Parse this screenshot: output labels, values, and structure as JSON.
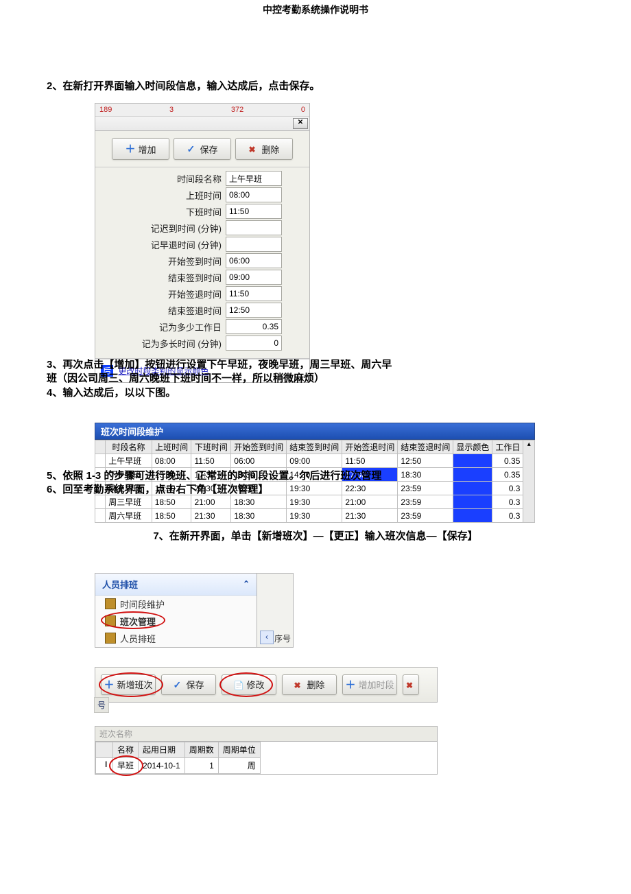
{
  "doc": {
    "title": "中控考勤系统操作说明书",
    "step2": "2、在新打开界面输入时间段信息，输入达成后，点击保存。",
    "step3_line1": "3、再次点击【增加】按钮进行设置下午早班，夜晚早班，周三早班、周六早",
    "step3_line2": "班（因公司周三、周六晚班下班时间不一样，所以稍微麻烦）",
    "step4": "4、输入达成后，以以下图。",
    "step5": "5、依照 1-3 的步骤可进行晚班、正常班的时间段设置。尔后进行班次管理",
    "step6": "6、回至考勤系统界面，点击右下角【班次管理】",
    "step7": "7、在新开界面，单击【新增班次】—【更正】输入班次信息—【保存】"
  },
  "dialog1": {
    "ruler": {
      "a": "189",
      "b": "3",
      "c": "372",
      "d": "0"
    },
    "buttons": {
      "add": "增加",
      "save": "保存",
      "delete": "删除"
    },
    "labels": {
      "name": "时间段名称",
      "start": "上班时间",
      "end": "下班时间",
      "late": "记迟到时间 (分钟)",
      "early": "记早退时间 (分钟)",
      "sign_in_start": "开始签到时间",
      "sign_in_end": "结束签到时间",
      "sign_out_start": "开始签退时间",
      "sign_out_end": "结束签退时间",
      "workday": "记为多少工作日",
      "duration": "记为多长时间 (分钟)"
    },
    "values": {
      "name": "上午早班",
      "start": "08:00",
      "end": "11:50",
      "late": "",
      "early": "",
      "sign_in_start": "06:00",
      "sign_in_end": "09:00",
      "sign_out_start": "11:50",
      "sign_out_end": "12:50",
      "workday": "0.35",
      "duration": "0"
    },
    "footer": {
      "hl": "后",
      "msg": "更改时段类别的显示颜色"
    }
  },
  "grid2": {
    "title": "班次时间段维护",
    "columns": [
      "时段名称",
      "上班时间",
      "下班时间",
      "开始签到时间",
      "结束签到时间",
      "开始签退时间",
      "结束签退时间",
      "显示颜色",
      "工作日"
    ],
    "rows": [
      {
        "cells": [
          "上午早班",
          "08:00",
          "11:50",
          "06:00",
          "09:00",
          "11:50",
          "12:50"
        ],
        "wd": "0.35",
        "sel": false
      },
      {
        "cells": [
          "下午早班",
          "13:30",
          "17:30",
          "13:30",
          "14:30",
          "17:30",
          "18:30"
        ],
        "wd": "0.35",
        "sel": true
      },
      {
        "cells": [
          "晚上早班",
          "18:50",
          "22:30",
          "18:30",
          "19:30",
          "22:30",
          "23:59"
        ],
        "wd": "0.3",
        "sel": false
      },
      {
        "cells": [
          "周三早班",
          "18:50",
          "21:00",
          "18:30",
          "19:30",
          "21:00",
          "23:59"
        ],
        "wd": "0.3",
        "sel": false
      },
      {
        "cells": [
          "周六早班",
          "18:50",
          "21:30",
          "18:30",
          "19:30",
          "21:30",
          "23:59"
        ],
        "wd": "0.3",
        "sel": false
      }
    ]
  },
  "sidebar": {
    "header": "人员排班",
    "items": [
      {
        "label": "时间段维护",
        "active": false
      },
      {
        "label": "班次管理",
        "active": true
      },
      {
        "label": "人员排班",
        "active": false
      }
    ],
    "stub": "序号"
  },
  "toolbar2": {
    "add_shift": "新增班次",
    "save": "保存",
    "modify": "修改",
    "delete": "删除",
    "add_period": "增加时段",
    "rownum": "号"
  },
  "grid3": {
    "small_header": "班次名称",
    "columns": [
      "名称",
      "起用日期",
      "周期数",
      "周期单位"
    ],
    "row": {
      "name": "早班",
      "date": "2014-10-1",
      "cycles": "1",
      "unit": "周"
    }
  }
}
